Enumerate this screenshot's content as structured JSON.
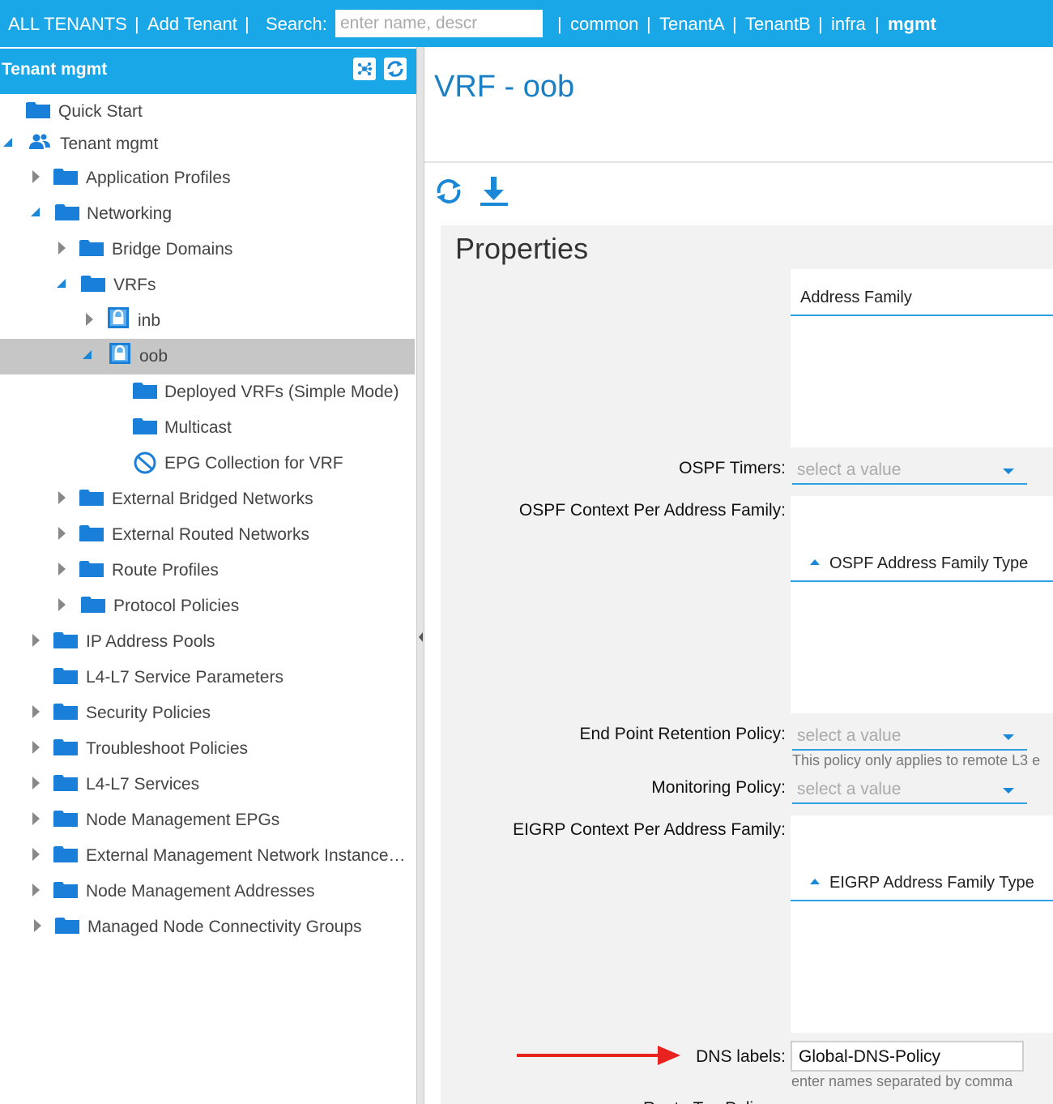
{
  "topbar": {
    "all_tenants": "ALL TENANTS",
    "add_tenant": "Add Tenant",
    "search_label": "Search:",
    "search_placeholder": "enter name, descr",
    "tenants": [
      "common",
      "TenantA",
      "TenantB",
      "infra",
      "mgmt"
    ],
    "separator": "|"
  },
  "sidebar": {
    "title": "Tenant mgmt",
    "items": [
      {
        "label": "Quick Start",
        "icon": "folder-icon",
        "state": "none"
      },
      {
        "label": "Tenant mgmt",
        "icon": "users-icon",
        "state": "expanded"
      },
      {
        "label": "Application Profiles",
        "icon": "folder-icon",
        "state": "collapsed"
      },
      {
        "label": "Networking",
        "icon": "folder-icon",
        "state": "expanded"
      },
      {
        "label": "Bridge Domains",
        "icon": "folder-icon",
        "state": "collapsed"
      },
      {
        "label": "VRFs",
        "icon": "folder-icon",
        "state": "expanded"
      },
      {
        "label": "inb",
        "icon": "vrf-lock-icon",
        "state": "collapsed"
      },
      {
        "label": "oob",
        "icon": "vrf-lock-icon",
        "state": "expanded",
        "selected": true
      },
      {
        "label": "Deployed VRFs (Simple Mode)",
        "icon": "folder-icon",
        "state": "none"
      },
      {
        "label": "Multicast",
        "icon": "folder-icon",
        "state": "none"
      },
      {
        "label": "EPG Collection for VRF",
        "icon": "epg-collection-icon",
        "state": "none"
      },
      {
        "label": "External Bridged Networks",
        "icon": "folder-icon",
        "state": "collapsed"
      },
      {
        "label": "External Routed Networks",
        "icon": "folder-icon",
        "state": "collapsed"
      },
      {
        "label": "Route Profiles",
        "icon": "folder-icon",
        "state": "collapsed"
      },
      {
        "label": "Protocol Policies",
        "icon": "folder-icon",
        "state": "collapsed"
      },
      {
        "label": "IP Address Pools",
        "icon": "folder-icon",
        "state": "collapsed"
      },
      {
        "label": "L4-L7 Service Parameters",
        "icon": "folder-icon",
        "state": "none"
      },
      {
        "label": "Security Policies",
        "icon": "folder-icon",
        "state": "collapsed"
      },
      {
        "label": "Troubleshoot Policies",
        "icon": "folder-icon",
        "state": "collapsed"
      },
      {
        "label": "L4-L7 Services",
        "icon": "folder-icon",
        "state": "collapsed"
      },
      {
        "label": "Node Management EPGs",
        "icon": "folder-icon",
        "state": "collapsed"
      },
      {
        "label": "External Management Network Instance…",
        "icon": "folder-icon",
        "state": "collapsed"
      },
      {
        "label": "Node Management Addresses",
        "icon": "folder-icon",
        "state": "collapsed"
      },
      {
        "label": "Managed Node Connectivity Groups",
        "icon": "folder-icon",
        "state": "collapsed"
      }
    ]
  },
  "main": {
    "title": "VRF - oob",
    "properties_title": "Properties",
    "address_family_header": "Address Family",
    "ospf_timers_label": "OSPF Timers:",
    "ospf_timers_value": "select a value",
    "ospf_context_label": "OSPF Context Per Address Family:",
    "ospf_af_type_header": "OSPF Address Family Type",
    "ep_retention_label": "End Point Retention Policy:",
    "ep_retention_value": "select a value",
    "ep_retention_hint": "This policy only applies to remote L3 e",
    "monitoring_label": "Monitoring Policy:",
    "monitoring_value": "select a value",
    "eigrp_context_label": "EIGRP Context Per Address Family:",
    "eigrp_af_type_header": "EIGRP Address Family Type",
    "dns_label": "DNS labels:",
    "dns_value": "Global-DNS-Policy",
    "dns_hint": "enter names separated by comma",
    "next_label_partial": "Route Tag Policy:"
  },
  "colors": {
    "brand": "#1aa7e8",
    "accent": "#1a88d6",
    "selected_row": "#c6c6c6",
    "annotation_arrow": "#e8231f"
  }
}
